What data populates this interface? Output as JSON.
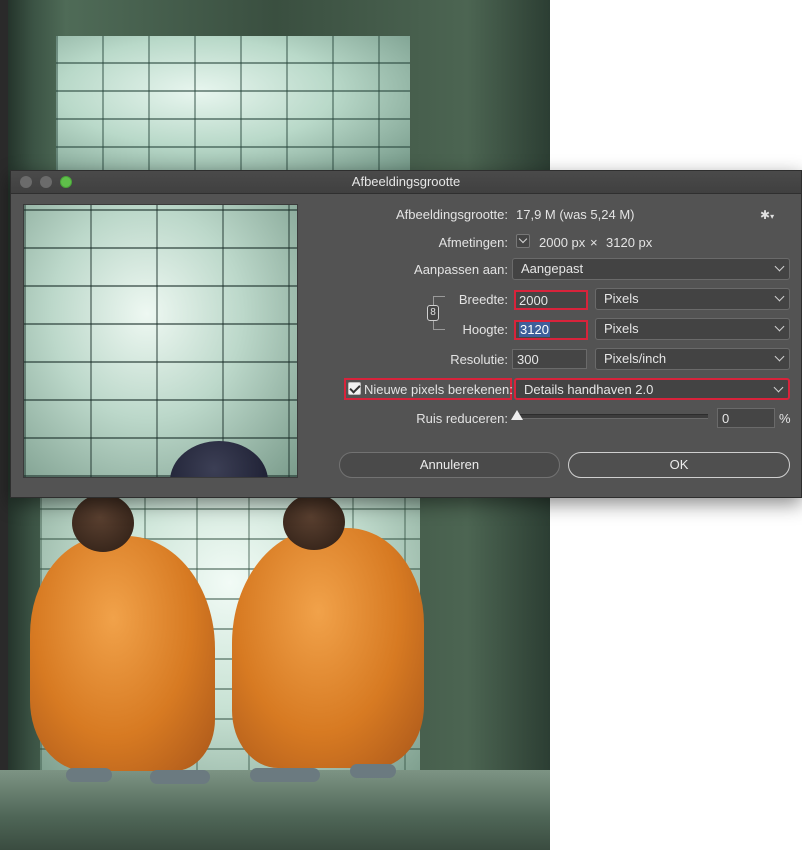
{
  "window": {
    "title": "Afbeeldingsgrootte",
    "traffic_colors": {
      "close": "#6b6b6b",
      "minimize": "#6b6b6b",
      "zoom": "#5fc04a"
    }
  },
  "info": {
    "image_size_label": "Afbeeldingsgrootte:",
    "image_size_value": "17,9 M (was 5,24 M)",
    "dimensions_label": "Afmetingen:",
    "dimensions_width": "2000 px",
    "dimensions_sep": "×",
    "dimensions_height": "3120 px",
    "settings_icon": "gear-icon",
    "settings_glyph": "✱"
  },
  "fit_to": {
    "label": "Aanpassen aan:",
    "selected": "Aangepast"
  },
  "width": {
    "label": "Breedte:",
    "value": "2000",
    "unit": "Pixels"
  },
  "height": {
    "label": "Hoogte:",
    "value": "3120",
    "unit": "Pixels"
  },
  "constrain": {
    "icon": "link-icon",
    "glyph": "8"
  },
  "resolution": {
    "label": "Resolutie:",
    "value": "300",
    "unit": "Pixels/inch"
  },
  "resample": {
    "label": "Nieuwe pixels berekenen:",
    "checked": true,
    "method": "Details handhaven 2.0"
  },
  "noise": {
    "label": "Ruis reduceren:",
    "value": "0",
    "unit": "%",
    "level": 0
  },
  "buttons": {
    "cancel": "Annuleren",
    "ok": "OK"
  },
  "colors": {
    "dialog_bg": "#535353",
    "highlight": "#d8233b",
    "selection": "#3f5f9a"
  }
}
